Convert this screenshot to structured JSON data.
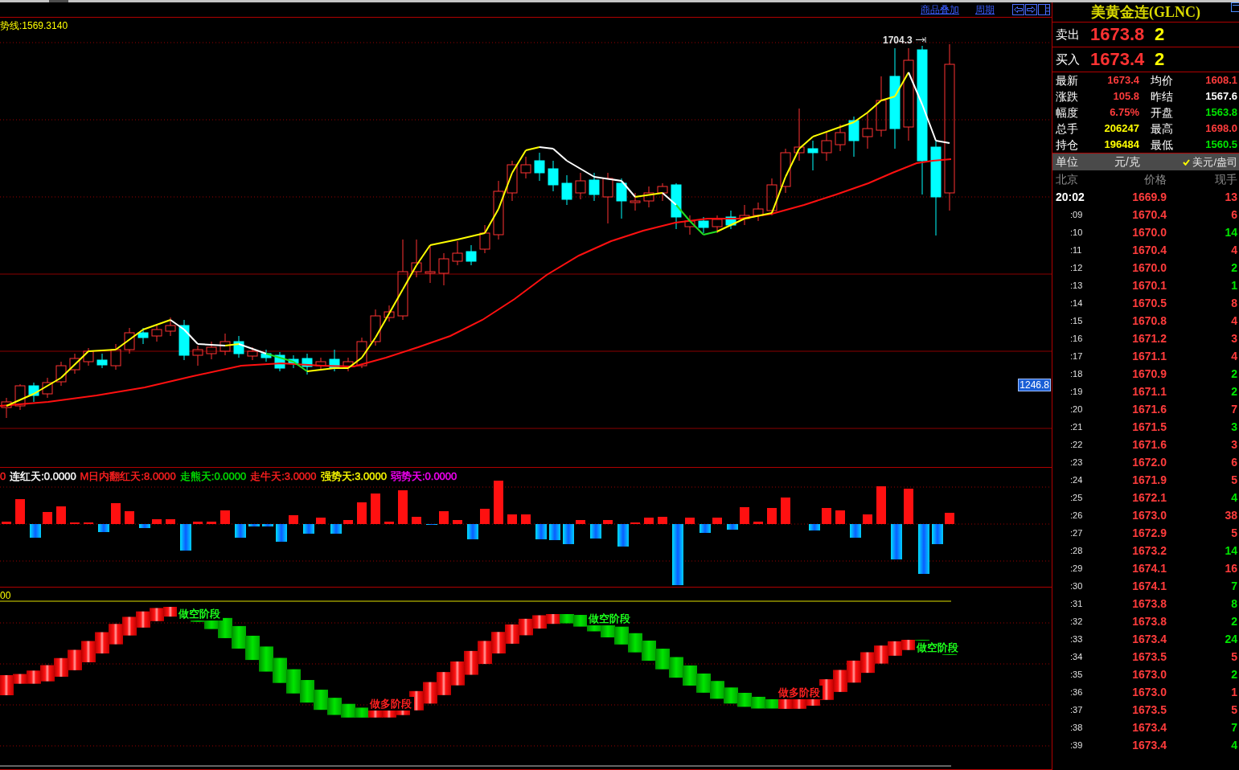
{
  "toolbar": {
    "links": [
      "商品叠加",
      "周期"
    ]
  },
  "price_chart": {
    "trend_line_readout": "势线:1569.3140",
    "high_marker": "1704.3",
    "price_tag": "1246.8"
  },
  "indicator_panel": {
    "readouts": [
      {
        "text": "0",
        "color": "#ff2020"
      },
      {
        "text": "连红天:0.0000",
        "color": "#ffffff"
      },
      {
        "text": "M日内翻红天:8.0000",
        "color": "#ff2020"
      },
      {
        "text": "走熊天:0.0000",
        "color": "#00e000"
      },
      {
        "text": "走牛天:3.0000",
        "color": "#ff2020"
      },
      {
        "text": "强势天:3.0000",
        "color": "#ffff00"
      },
      {
        "text": "弱势天:0.0000",
        "color": "#ff00ff"
      }
    ]
  },
  "stage_panel": {
    "axis_readout": "00",
    "stage_labels": [
      {
        "text": "做空阶段",
        "kind": "short"
      },
      {
        "text": "做多阶段",
        "kind": "long"
      },
      {
        "text": "做空阶段",
        "kind": "short"
      },
      {
        "text": "做多阶段",
        "kind": "long"
      },
      {
        "text": "做空阶段",
        "kind": "short"
      }
    ]
  },
  "quote_panel": {
    "title": "美黄金连(GLNC)",
    "ask": {
      "label": "卖出",
      "price": "1673.8",
      "volume": "2"
    },
    "bid": {
      "label": "买入",
      "price": "1673.4",
      "volume": "2"
    },
    "stats": [
      {
        "label": "最新",
        "value": "1673.4",
        "color": "#ff3c3c"
      },
      {
        "label": "均价",
        "value": "1608.1",
        "color": "#ff3c3c"
      },
      {
        "label": "涨跌",
        "value": "105.8",
        "color": "#ff3c3c"
      },
      {
        "label": "昨结",
        "value": "1567.6",
        "color": "#ffffff"
      },
      {
        "label": "幅度",
        "value": "6.75%",
        "color": "#ff3c3c"
      },
      {
        "label": "开盘",
        "value": "1563.8",
        "color": "#00e600"
      },
      {
        "label": "总手",
        "value": "206247",
        "color": "#ffff00"
      },
      {
        "label": "最高",
        "value": "1698.0",
        "color": "#ff3c3c"
      },
      {
        "label": "持仓",
        "value": "196484",
        "color": "#ffff00"
      },
      {
        "label": "最低",
        "value": "1560.5",
        "color": "#00e600"
      }
    ],
    "unit": {
      "label": "单位",
      "options": [
        {
          "text": "元/克",
          "selected": false
        },
        {
          "text": "美元/盎司",
          "selected": true
        }
      ]
    },
    "ticks": {
      "columns": [
        "北京",
        "价格",
        "现手"
      ],
      "rows": [
        {
          "time": "20:02",
          "price": "1669.9",
          "volume": "13",
          "color": "#ff3c3c"
        },
        {
          "time": ":09",
          "price": "1670.4",
          "volume": "6",
          "color": "#ff3c3c"
        },
        {
          "time": ":10",
          "price": "1670.0",
          "volume": "14",
          "color": "#00e600"
        },
        {
          "time": ":11",
          "price": "1670.4",
          "volume": "4",
          "color": "#ff3c3c"
        },
        {
          "time": ":12",
          "price": "1670.0",
          "volume": "2",
          "color": "#00e600"
        },
        {
          "time": ":13",
          "price": "1670.1",
          "volume": "1",
          "color": "#00e600"
        },
        {
          "time": ":14",
          "price": "1670.5",
          "volume": "8",
          "color": "#ff3c3c"
        },
        {
          "time": ":15",
          "price": "1670.8",
          "volume": "4",
          "color": "#ff3c3c"
        },
        {
          "time": ":16",
          "price": "1671.2",
          "volume": "3",
          "color": "#ff3c3c"
        },
        {
          "time": ":17",
          "price": "1671.1",
          "volume": "4",
          "color": "#ff3c3c"
        },
        {
          "time": ":18",
          "price": "1670.9",
          "volume": "2",
          "color": "#00e600"
        },
        {
          "time": ":19",
          "price": "1671.1",
          "volume": "2",
          "color": "#00e600"
        },
        {
          "time": ":20",
          "price": "1671.6",
          "volume": "7",
          "color": "#ff3c3c"
        },
        {
          "time": ":21",
          "price": "1671.5",
          "volume": "3",
          "color": "#00e600"
        },
        {
          "time": ":22",
          "price": "1671.6",
          "volume": "3",
          "color": "#ff3c3c"
        },
        {
          "time": ":23",
          "price": "1672.0",
          "volume": "6",
          "color": "#ff3c3c"
        },
        {
          "time": ":24",
          "price": "1671.9",
          "volume": "5",
          "color": "#ff3c3c"
        },
        {
          "time": ":25",
          "price": "1672.1",
          "volume": "4",
          "color": "#00e600"
        },
        {
          "time": ":26",
          "price": "1673.0",
          "volume": "38",
          "color": "#ff3c3c"
        },
        {
          "time": ":27",
          "price": "1672.9",
          "volume": "5",
          "color": "#ff3c3c"
        },
        {
          "time": ":28",
          "price": "1673.2",
          "volume": "14",
          "color": "#00e600"
        },
        {
          "time": ":29",
          "price": "1674.1",
          "volume": "16",
          "color": "#ff3c3c"
        },
        {
          "time": ":30",
          "price": "1674.1",
          "volume": "7",
          "color": "#00e600"
        },
        {
          "time": ":31",
          "price": "1673.8",
          "volume": "8",
          "color": "#00e600"
        },
        {
          "time": ":32",
          "price": "1673.8",
          "volume": "2",
          "color": "#00e600"
        },
        {
          "time": ":33",
          "price": "1673.4",
          "volume": "24",
          "color": "#00e600"
        },
        {
          "time": ":34",
          "price": "1673.5",
          "volume": "5",
          "color": "#ff3c3c"
        },
        {
          "time": ":35",
          "price": "1673.0",
          "volume": "2",
          "color": "#00e600"
        },
        {
          "time": ":36",
          "price": "1673.0",
          "volume": "1",
          "color": "#ff3c3c"
        },
        {
          "time": ":37",
          "price": "1673.5",
          "volume": "5",
          "color": "#ff3c3c"
        },
        {
          "time": ":38",
          "price": "1673.4",
          "volume": "7",
          "color": "#00e600"
        },
        {
          "time": ":39",
          "price": "1673.4",
          "volume": "4",
          "color": "#00e600"
        }
      ]
    }
  }
}
